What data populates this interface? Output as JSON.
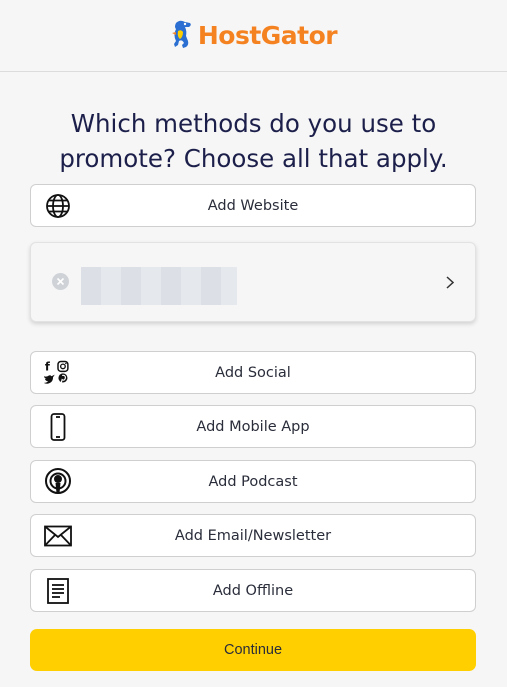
{
  "brand": {
    "name": "HostGator",
    "color": "#f58220",
    "logo_icon": "gator-icon"
  },
  "heading": "Which methods do you use to promote? Choose all that apply.",
  "added_website": {
    "remove_icon": "close-circle-icon",
    "chevron_icon": "chevron-right-icon"
  },
  "options": [
    {
      "label": "Add Website",
      "icon": "globe-icon"
    },
    {
      "label": "Add Social",
      "icon": "social-icons"
    },
    {
      "label": "Add Mobile App",
      "icon": "smartphone-icon"
    },
    {
      "label": "Add Podcast",
      "icon": "podcast-icon"
    },
    {
      "label": "Add Email/Newsletter",
      "icon": "envelope-icon"
    },
    {
      "label": "Add Offline",
      "icon": "document-icon"
    }
  ],
  "continue_label": "Continue",
  "colors": {
    "accent": "#ffcf00",
    "heading": "#1c1f4a"
  }
}
